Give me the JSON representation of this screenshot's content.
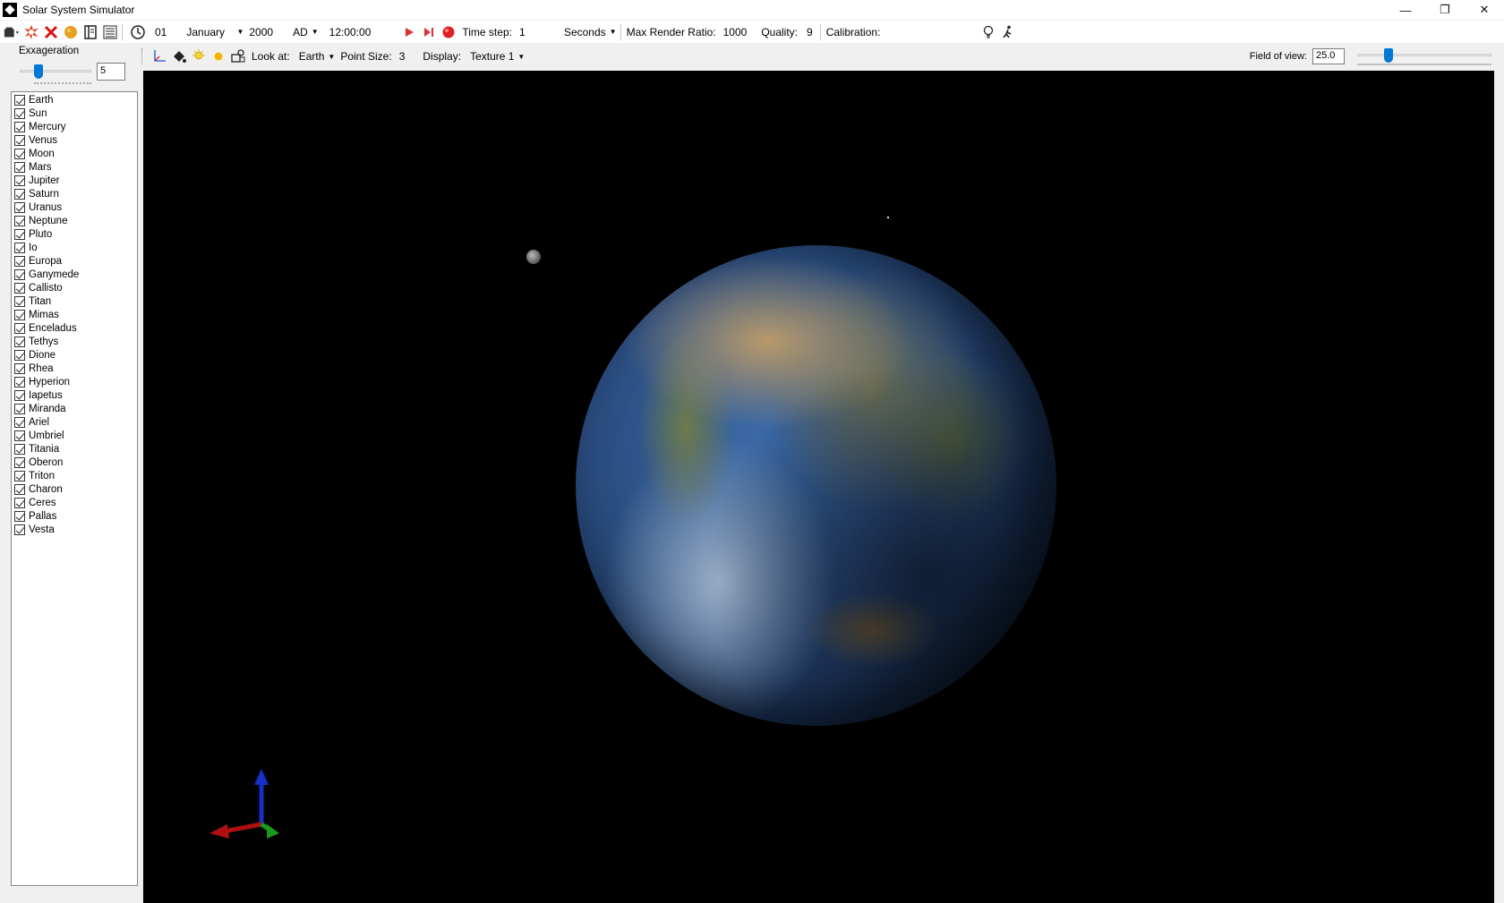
{
  "window": {
    "title": "Solar System Simulator"
  },
  "toolbar": {
    "day": "01",
    "month": "January",
    "year": "2000",
    "era": "AD",
    "time": "12:00:00",
    "time_step_label": "Time step:",
    "time_step_value": "1",
    "time_unit": "Seconds",
    "max_render_ratio_label": "Max Render Ratio:",
    "max_render_ratio_value": "1000",
    "quality_label": "Quality:",
    "quality_value": "9",
    "calibration_label": "Calibration:"
  },
  "view_toolbar": {
    "look_at_label": "Look at:",
    "look_at_value": "Earth",
    "point_size_label": "Point Size:",
    "point_size_value": "3",
    "display_label": "Display:",
    "display_value": "Texture 1",
    "fov_label": "Field of view:",
    "fov_value": "25.0"
  },
  "left_panel": {
    "exaggeration_label": "Exxageration",
    "exaggeration_value": "5",
    "bodies": [
      "Earth",
      "Sun",
      "Mercury",
      "Venus",
      "Moon",
      "Mars",
      "Jupiter",
      "Saturn",
      "Uranus",
      "Neptune",
      "Pluto",
      "Io",
      "Europa",
      "Ganymede",
      "Callisto",
      "Titan",
      "Mimas",
      "Enceladus",
      "Tethys",
      "Dione",
      "Rhea",
      "Hyperion",
      "Iapetus",
      "Miranda",
      "Ariel",
      "Umbriel",
      "Titania",
      "Oberon",
      "Triton",
      "Charon",
      "Ceres",
      "Pallas",
      "Vesta"
    ],
    "all_checked": true
  },
  "colors": {
    "slider_thumb": "#0078d7",
    "viewport_bg": "#000000",
    "axis_x": "#b01010",
    "axis_y": "#1a9a1a",
    "axis_z": "#1530c8"
  }
}
